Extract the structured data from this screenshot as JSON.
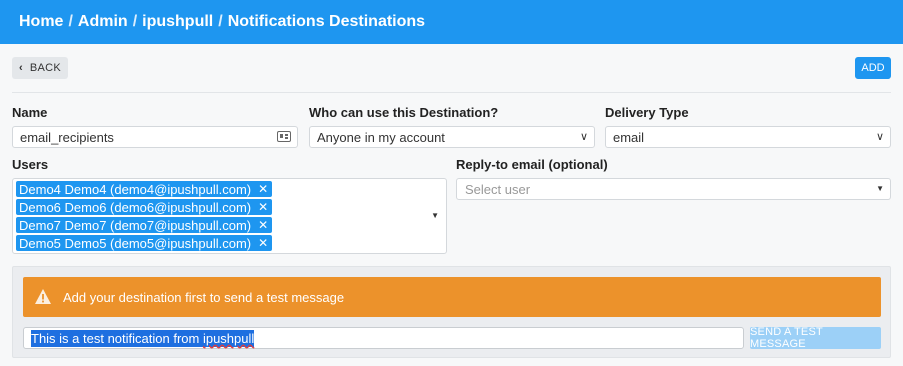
{
  "breadcrumb": [
    "Home",
    "Admin",
    "ipushpull",
    "Notifications Destinations"
  ],
  "toolbar": {
    "back_label": "BACK",
    "add_label": "ADD"
  },
  "form": {
    "name_label": "Name",
    "name_value": "email_recipients",
    "who_label": "Who can use this Destination?",
    "who_value": "Anyone in my account",
    "delivery_label": "Delivery Type",
    "delivery_value": "email",
    "users_label": "Users",
    "users": [
      "Demo4 Demo4 (demo4@ipushpull.com)",
      "Demo6 Demo6 (demo6@ipushpull.com)",
      "Demo7 Demo7 (demo7@ipushpull.com)",
      "Demo5 Demo5 (demo5@ipushpull.com)"
    ],
    "reply_label": "Reply-to email (optional)",
    "reply_placeholder": "Select user"
  },
  "test": {
    "warning": "Add your destination first to send a test message",
    "message_prefix": "This is a test notification from ",
    "message_misspelled": "ipushpull",
    "send_label": "SEND A TEST MESSAGE"
  },
  "colors": {
    "primary": "#1e96f0",
    "warning": "#ec922b",
    "disabled_button": "#9cd0f7"
  },
  "icons": [
    "chevron-left-icon",
    "id-card-icon",
    "chevron-down-icon",
    "remove-icon",
    "caret-down-icon",
    "warning-icon"
  ]
}
